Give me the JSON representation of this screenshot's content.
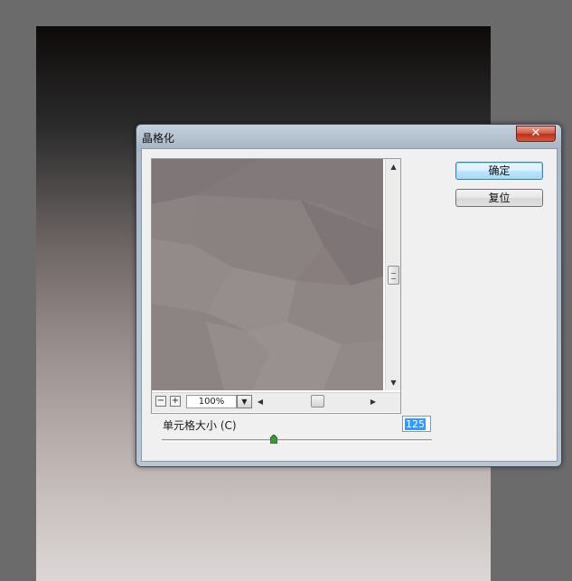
{
  "dialog": {
    "title": "晶格化",
    "close_icon": "close-x-icon",
    "buttons": {
      "ok": "确定",
      "reset": "复位"
    }
  },
  "preview": {
    "zoom_out": "−",
    "zoom_in": "+",
    "zoom_value": "100%",
    "zoom_dropdown_icon": "triangle-down-icon",
    "vertical_scroll_position": 0.47,
    "horizontal_scroll_position": 0.5
  },
  "settings": {
    "cell_size_label": "单元格大小 (C)",
    "cell_size_value": "125",
    "cell_size_slider_fraction": 0.42
  },
  "colors": {
    "dialog_frame": "#b8c5d3",
    "close_button": "#c8452c",
    "default_button": "#bee6fd",
    "input_highlight": "#3399ff"
  }
}
